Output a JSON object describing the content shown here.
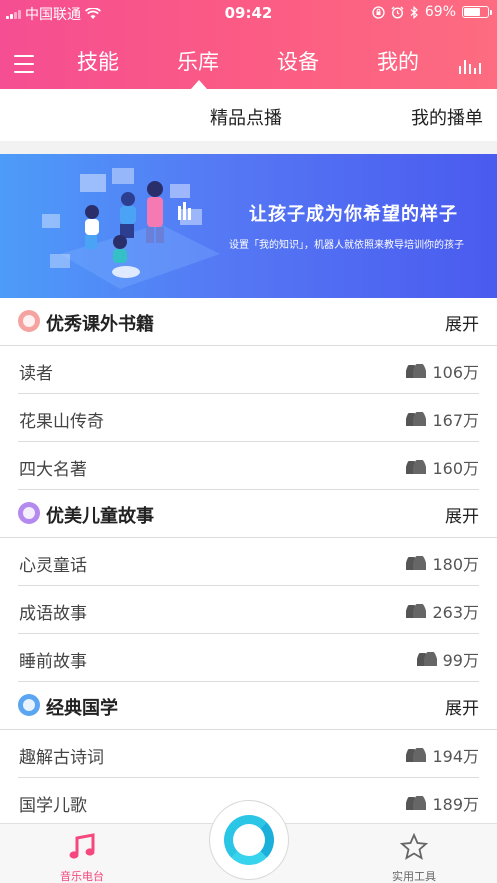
{
  "status_bar": {
    "carrier": "中国联通",
    "time": "09:42",
    "battery": "69%",
    "battery_level": 0.69
  },
  "top_tabs": [
    {
      "label": "技能"
    },
    {
      "label": "乐库"
    },
    {
      "label": "设备"
    },
    {
      "label": "我的"
    }
  ],
  "sub_tabs": [
    {
      "label": "精品点播"
    },
    {
      "label": "我的播单"
    }
  ],
  "banner": {
    "title": "让孩子成为你希望的样子",
    "subtitle": "设置「我的知识」，机器人就依照来教导培训你的孩子"
  },
  "sections": [
    {
      "title": "优秀课外书籍",
      "expand": "展开",
      "icon_color": "#f5a3a0",
      "items": [
        {
          "label": "读者",
          "count": "106万"
        },
        {
          "label": "花果山传奇",
          "count": "167万"
        },
        {
          "label": "四大名著",
          "count": "160万"
        }
      ]
    },
    {
      "title": "优美儿童故事",
      "expand": "展开",
      "icon_color": "#b48af0",
      "items": [
        {
          "label": "心灵童话",
          "count": "180万"
        },
        {
          "label": "成语故事",
          "count": "263万"
        },
        {
          "label": "睡前故事",
          "count": "99万"
        }
      ]
    },
    {
      "title": "经典国学",
      "expand": "展开",
      "icon_color": "#5aa6f2",
      "items": [
        {
          "label": "趣解古诗词",
          "count": "194万"
        },
        {
          "label": "国学儿歌",
          "count": "189万"
        }
      ]
    }
  ],
  "bottom_nav": [
    {
      "label": "音乐电台",
      "active": true,
      "color": "#f5487e"
    },
    {
      "label": "实用工具",
      "active": false,
      "color": "#666666"
    }
  ],
  "colors": {
    "header_gradient_start": "#f54e92",
    "header_gradient_end": "#fd6c80",
    "accent": "#f5487e",
    "voice_button": "#2bc6e6"
  }
}
